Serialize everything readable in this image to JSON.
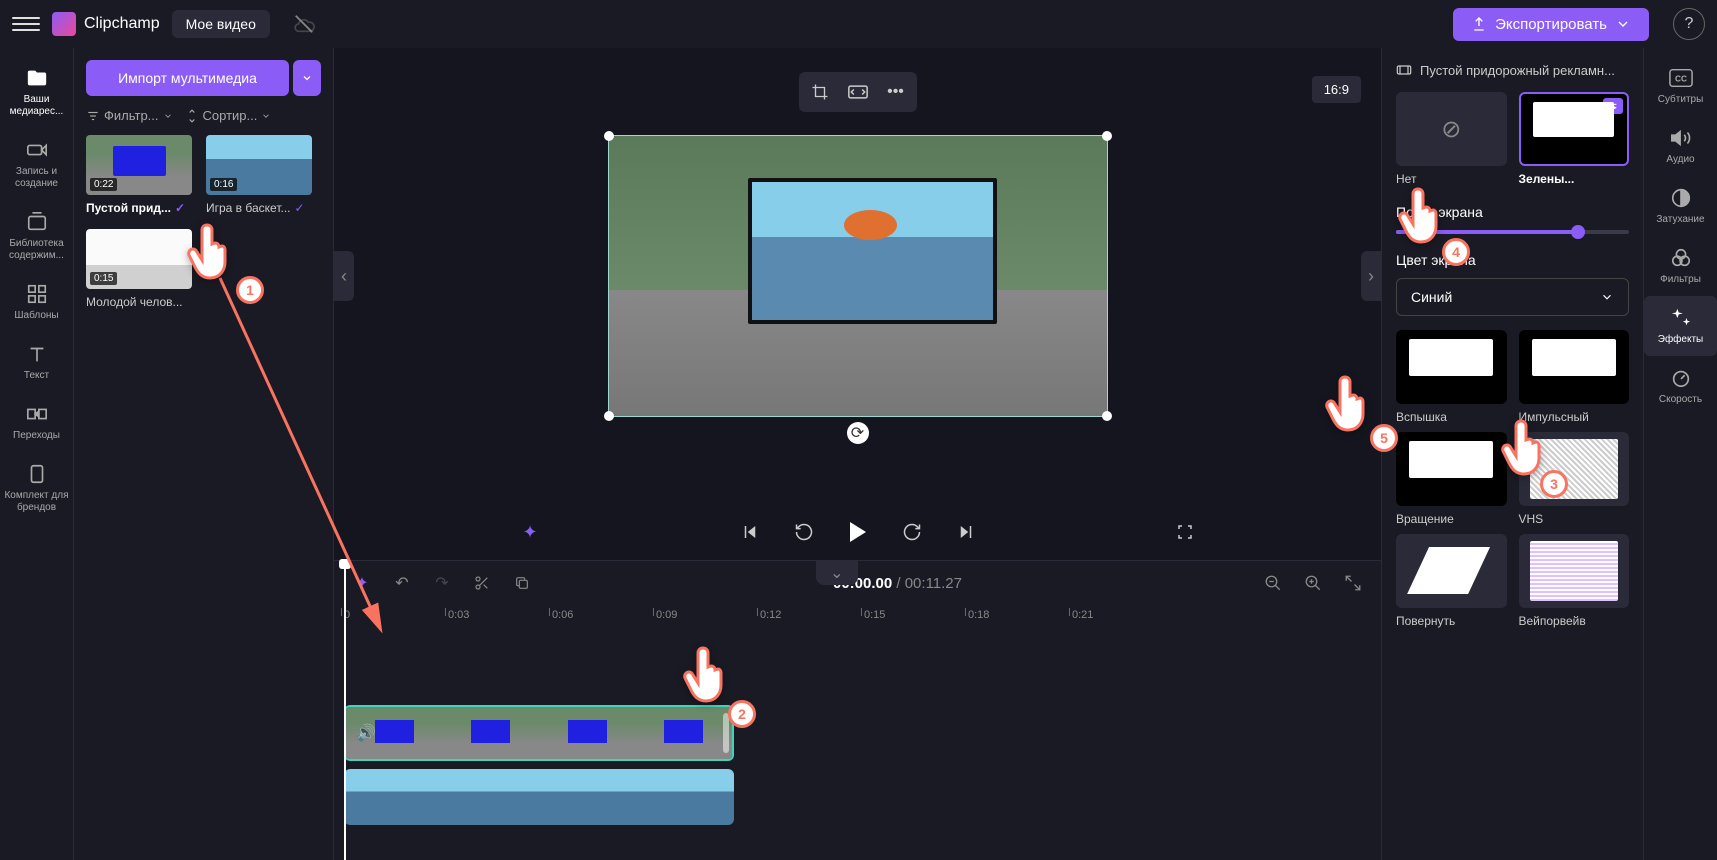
{
  "header": {
    "app_name": "Clipchamp",
    "video_title": "Мое видео",
    "export_label": "Экспортировать"
  },
  "left_nav": [
    {
      "label": "Ваши медиарес...",
      "icon": "folder"
    },
    {
      "label": "Запись и создание",
      "icon": "camera"
    },
    {
      "label": "Библиотека содержим...",
      "icon": "library"
    },
    {
      "label": "Шаблоны",
      "icon": "templates"
    },
    {
      "label": "Текст",
      "icon": "text"
    },
    {
      "label": "Переходы",
      "icon": "transitions"
    },
    {
      "label": "Комплект для брендов",
      "icon": "brand"
    }
  ],
  "media_panel": {
    "import_label": "Импорт мультимедиа",
    "filter_label": "Фильтр...",
    "sort_label": "Сортир...",
    "items": [
      {
        "name": "Пустой прид...",
        "duration": "0:22",
        "used": true,
        "kind": "billboard"
      },
      {
        "name": "Игра в баскет...",
        "duration": "0:16",
        "used": true,
        "kind": "basketball"
      },
      {
        "name": "Молодой челов...",
        "duration": "0:15",
        "used": false,
        "kind": "laptop"
      }
    ]
  },
  "preview": {
    "aspect_ratio": "16:9"
  },
  "timeline": {
    "current_time": "00:00.00",
    "total_time": "00:11.27",
    "ruler": [
      "0",
      "0:03",
      "0:06",
      "0:09",
      "0:12",
      "0:15",
      "0:18",
      "0:21"
    ]
  },
  "effects_panel": {
    "clip_name": "Пустой придорожный рекламн...",
    "presets": [
      {
        "label": "Нет",
        "kind": "none"
      },
      {
        "label": "Зелены...",
        "kind": "green",
        "selected": true
      }
    ],
    "threshold_label": "Порог экрана",
    "threshold_value": 78,
    "color_label": "Цвет экрана",
    "color_value": "Синий",
    "effects": [
      {
        "label": "Вспышка",
        "kind": "bw"
      },
      {
        "label": "Импульсный",
        "kind": "bw"
      },
      {
        "label": "Вращение",
        "kind": "bw"
      },
      {
        "label": "VHS",
        "kind": "static"
      },
      {
        "label": "Повернуть",
        "kind": "wipe"
      },
      {
        "label": "Вейпорвейв",
        "kind": "vapor"
      }
    ]
  },
  "right_nav": [
    {
      "label": "Субтитры",
      "icon": "cc"
    },
    {
      "label": "Аудио",
      "icon": "audio"
    },
    {
      "label": "Затухание",
      "icon": "fade"
    },
    {
      "label": "Фильтры",
      "icon": "filters"
    },
    {
      "label": "Эффекты",
      "icon": "effects",
      "active": true
    },
    {
      "label": "Скорость",
      "icon": "speed"
    }
  ],
  "annotations": {
    "1": "media-clip-drag",
    "2": "timeline-clip-top",
    "3": "effects-tab",
    "4": "green-screen-preset",
    "5": "screen-color-dropdown"
  }
}
